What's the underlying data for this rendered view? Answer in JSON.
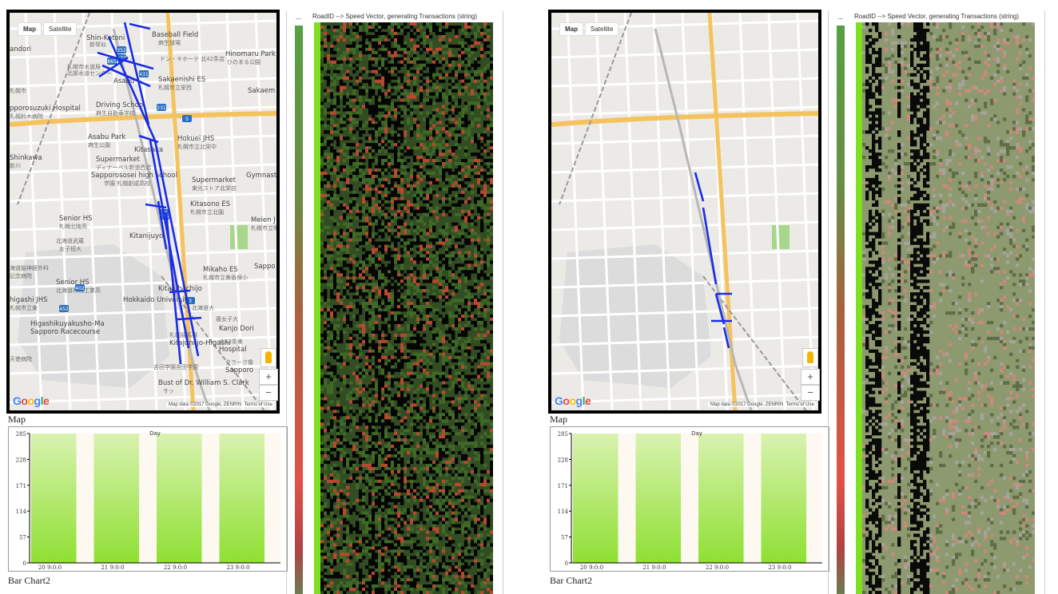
{
  "panels": [
    {
      "map": {
        "tab_map": "Map",
        "tab_satellite": "Satellite",
        "google_logo": "Google",
        "attribution": "Map data ©2017 Google, ZENRIN",
        "terms": "Terms of Use",
        "zoom_in": "+",
        "zoom_out": "−",
        "caption": "Map",
        "labels": [
          "Baseball Field",
          "麻生球場",
          "Shin-Kotoni",
          "新琴似",
          "andori",
          "ドン・キホーテ 北42条店",
          "Hinomaru Park",
          "ひのまる公園",
          "札幌市水道局",
          "北部水道センター",
          "Asabu",
          "Sakaenishi ES",
          "札幌市立栄西",
          "Sakaem",
          "札幌市",
          "pporosuzuki Hospital",
          "札幌鈴木病院",
          "Driving School",
          "麻生自動車学校",
          "Asabu Park",
          "麻生公園",
          "Hokuei JHS",
          "札幌市立北栄中",
          "Shinkawa",
          "新川",
          "Kitasaka",
          "Supermarket",
          "ディナーベル新道西店",
          "Sapporososei high school",
          "学園 札幌創成高校",
          "Gymnastics",
          "Supermarket",
          "東光ストア北栄店",
          "Kitasono ES",
          "札幌市立北園",
          "Senior HS",
          "札幌北陵高",
          "Meien J",
          "札幌市立明園",
          "北海道武蔵",
          "女子短大",
          "Kitanijuyo",
          "Sappo",
          "海道脳神経外科",
          "記念病院",
          "Mikaho ES",
          "札幌市立美香保小",
          "Senior HS",
          "北海道札幌工業高",
          "higashi JHS",
          "札幌市立東",
          "Kitajuhachijo",
          "Hokkaido University",
          "北海道大",
          "藤女子大",
          "Kanjo Dori",
          "Higashikuyakusho-Ma",
          "Sapporo Racecourse",
          "札幌競馬場",
          "Kitajuniijo-Higashi",
          "北12条東",
          "Hospital",
          "天使病院",
          "吉田学園吉田学園",
          "Bust of Dr. William S. Clark",
          "クラーク像",
          "Sapporo",
          "サッ",
          "Sapporo"
        ],
        "road_labels": [
          "431",
          "231",
          "5",
          "352",
          "89",
          "402",
          "452",
          "277",
          "125",
          "865",
          "3"
        ]
      },
      "bar_chart": {
        "caption": "Bar Chart2",
        "chart_data": {
          "type": "bar",
          "title": "Day",
          "categories": [
            "20 9:0:0",
            "21 9:0:0",
            "22 9:0:0",
            "23 9:0:0"
          ],
          "values": [
            285,
            285,
            285,
            285
          ],
          "ylim": [
            0,
            285
          ],
          "yticks": [
            "0",
            "57",
            "114",
            "171",
            "228",
            "285"
          ],
          "colors": {
            "top": "#d9f2b0",
            "bottom": "#8fe033"
          }
        }
      },
      "speed": {
        "title": "RoadID --> Speed Vector, generating Transactions (string)",
        "legend_label": "—"
      }
    },
    {
      "map": {
        "tab_map": "Map",
        "tab_satellite": "Satellite",
        "google_logo": "Google",
        "attribution": "Map data ©2017 Google, ZENRIN",
        "terms": "Terms of Use",
        "zoom_in": "+",
        "zoom_out": "−",
        "caption": "Map"
      },
      "bar_chart": {
        "caption": "Bar Chart2",
        "chart_data": {
          "type": "bar",
          "title": "Day",
          "categories": [
            "20 9:0:0",
            "21 9:0:0",
            "22 9:0:0",
            "23 9:0:0"
          ],
          "values": [
            285,
            285,
            285,
            285
          ],
          "ylim": [
            0,
            285
          ],
          "yticks": [
            "0",
            "57",
            "114",
            "171",
            "228",
            "285"
          ],
          "colors": {
            "top": "#d9f2b0",
            "bottom": "#8fe033"
          }
        }
      },
      "speed": {
        "title": "RoadID --> Speed Vector, generating Transactions (string)",
        "legend_label": "—"
      }
    }
  ]
}
